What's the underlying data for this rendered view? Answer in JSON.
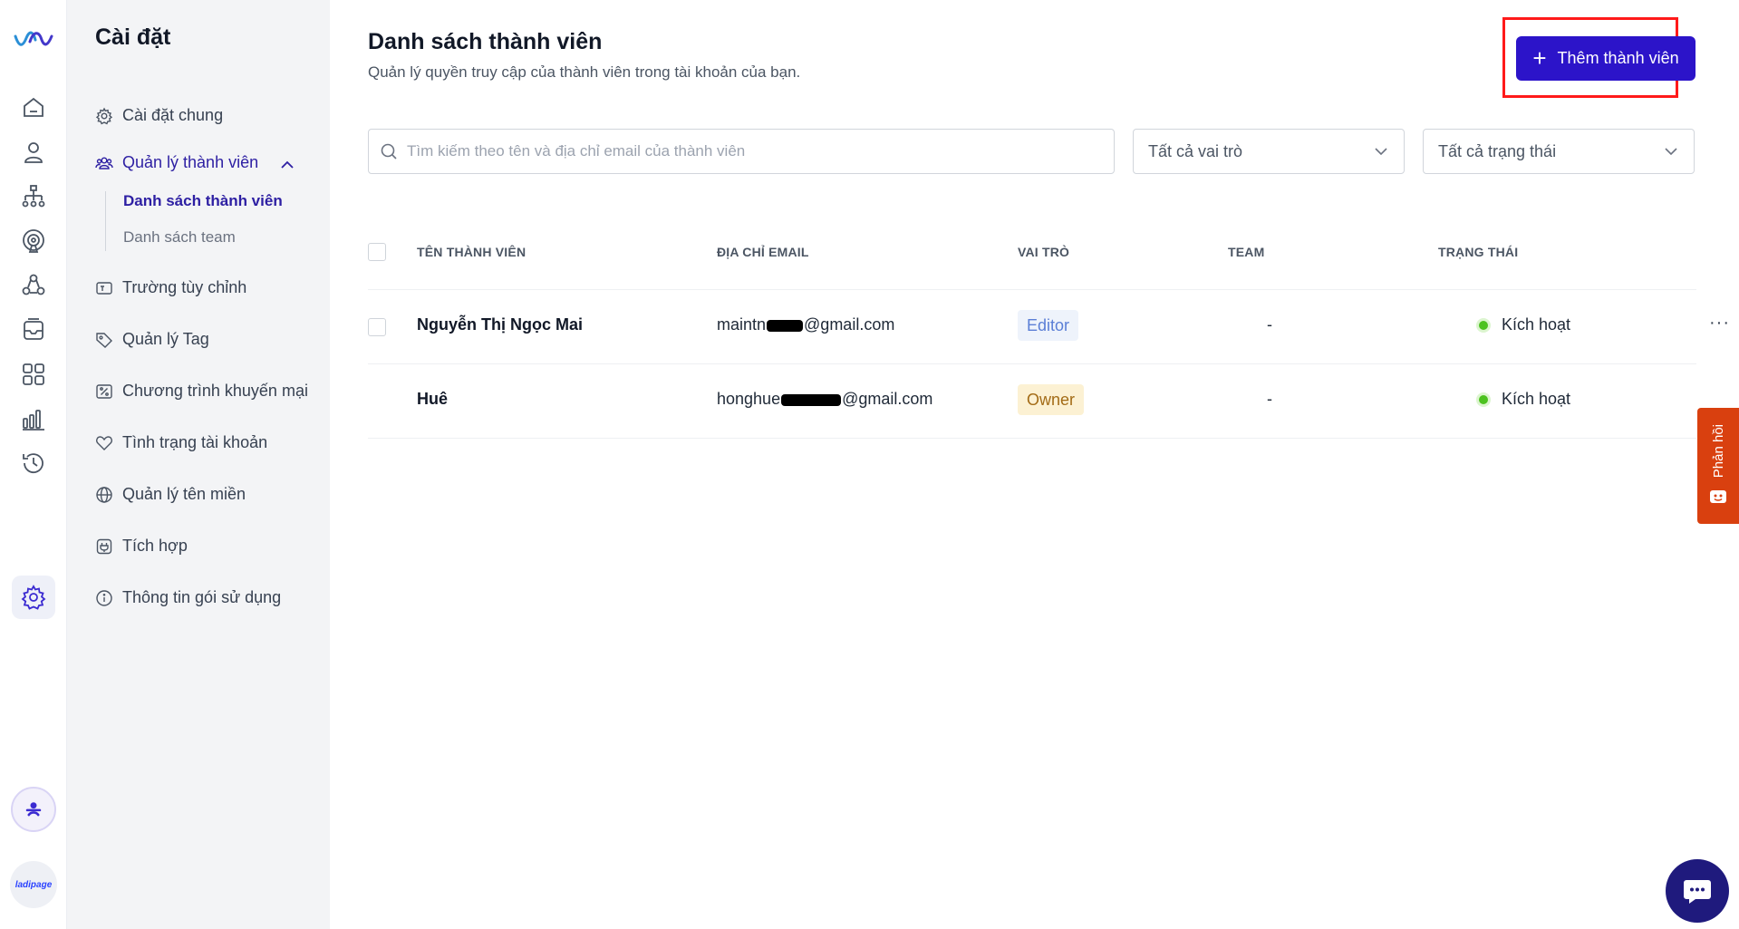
{
  "rail": {
    "items": [
      "home-icon",
      "user-icon",
      "org-chart-icon",
      "broadcast-icon",
      "segments-icon",
      "inbox-icon",
      "apps-icon",
      "bar-chart-icon",
      "history-icon",
      "gear-icon"
    ],
    "active": "gear-icon",
    "brand": "ladipage"
  },
  "sidebar": {
    "title": "Cài đặt",
    "items": [
      {
        "label": "Cài đặt chung",
        "icon": "gear-icon"
      },
      {
        "label": "Quản lý thành viên",
        "icon": "members-icon"
      },
      {
        "label": "Trường tùy chỉnh",
        "icon": "custom-field-icon"
      },
      {
        "label": "Quản lý Tag",
        "icon": "tag-icon"
      },
      {
        "label": "Chương trình khuyến mại",
        "icon": "discount-icon"
      },
      {
        "label": "Tình trạng tài khoản",
        "icon": "heart-icon"
      },
      {
        "label": "Quản lý tên miền",
        "icon": "globe-icon"
      },
      {
        "label": "Tích hợp",
        "icon": "plug-icon"
      },
      {
        "label": "Thông tin gói sử dụng",
        "icon": "info-icon"
      }
    ],
    "sub_items": [
      {
        "label": "Danh sách thành viên"
      },
      {
        "label": "Danh sách team"
      }
    ]
  },
  "header": {
    "title": "Danh sách thành viên",
    "subtitle": "Quản lý quyền truy cập của thành viên trong tài khoản của bạn.",
    "add_button": "Thêm thành viên"
  },
  "filters": {
    "search_placeholder": "Tìm kiếm theo tên và địa chỉ email của thành viên",
    "role_select": "Tất cả vai trò",
    "status_select": "Tất cả trạng thái"
  },
  "table": {
    "columns": [
      "TÊN THÀNH VIÊN",
      "ĐỊA CHỈ EMAIL",
      "VAI TRÒ",
      "TEAM",
      "TRẠNG THÁI"
    ],
    "rows": [
      {
        "name": "Nguyễn Thị Ngọc Mai",
        "email_prefix": "maintn",
        "email_suffix": "@gmail.com",
        "role": "Editor",
        "team": "-",
        "status": "Kích hoạt"
      },
      {
        "name": "Huê",
        "email_prefix": "honghue",
        "email_suffix": "@gmail.com",
        "role": "Owner",
        "team": "-",
        "status": "Kích hoạt"
      }
    ],
    "more": "···"
  },
  "feedback": {
    "label": "Phản hồi"
  },
  "colors": {
    "accent": "#2c14c9",
    "active_nav": "#2d1fa3",
    "highlight": "#ff1a1a",
    "status_green": "#4cc21f",
    "feedback": "#d9400f",
    "chat": "#1f1a7d"
  }
}
